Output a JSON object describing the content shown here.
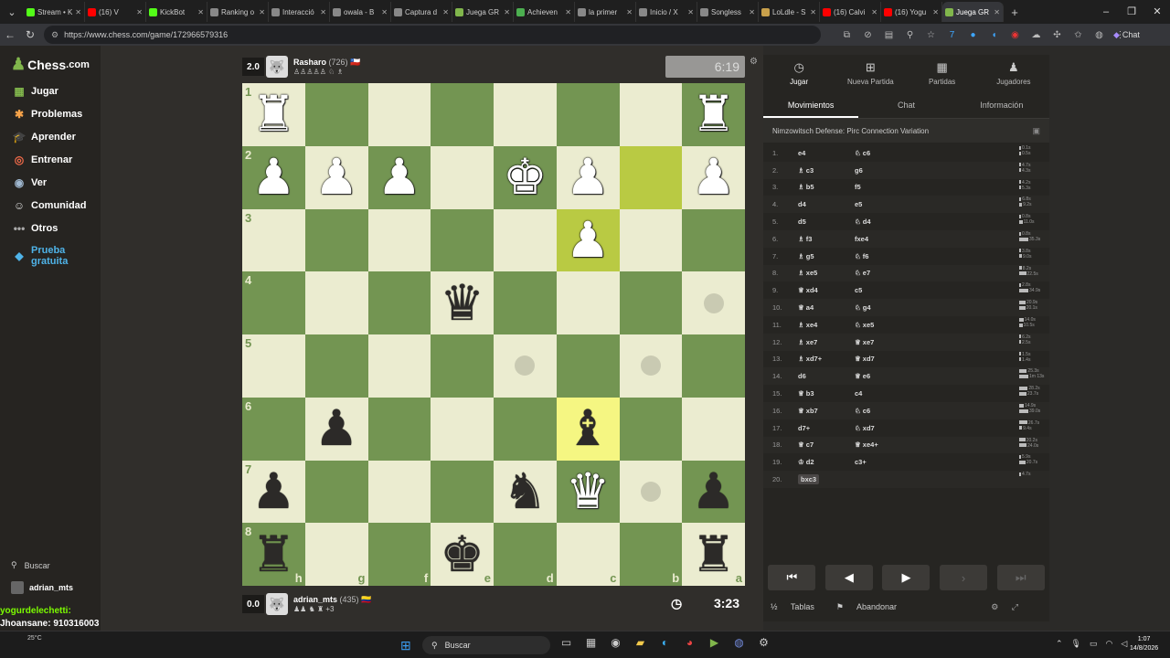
{
  "browser": {
    "tabs": [
      {
        "label": "Stream • K",
        "color": "#53fc18"
      },
      {
        "label": "(16) V",
        "color": "#ff0000"
      },
      {
        "label": "KickBot",
        "color": "#53fc18"
      },
      {
        "label": "Ranking o",
        "color": "#888888"
      },
      {
        "label": "Interacció",
        "color": "#888888"
      },
      {
        "label": "owala - B",
        "color": "#888888"
      },
      {
        "label": "Captura d",
        "color": "#888888"
      },
      {
        "label": "Juega GR",
        "color": "#81b64c"
      },
      {
        "label": "Achieven",
        "color": "#4caf50"
      },
      {
        "label": "la primer",
        "color": "#888888"
      },
      {
        "label": "Inicio / X",
        "color": "#888888"
      },
      {
        "label": "Songless",
        "color": "#888888"
      },
      {
        "label": "LoLdle - S",
        "color": "#c8a04b"
      },
      {
        "label": "(16) Calvi",
        "color": "#ff0000"
      },
      {
        "label": "(16) Yogu",
        "color": "#ff0000"
      },
      {
        "label": "Juega GR",
        "color": "#81b64c",
        "active": true
      }
    ],
    "url": "https://www.chess.com/game/172966579316",
    "chat_label": "Chat"
  },
  "sidebar": {
    "logo": "Chess",
    "logo_suffix": ".com",
    "items": [
      {
        "label": "Jugar",
        "icon": "play-board-icon",
        "color": "#81b64c"
      },
      {
        "label": "Problemas",
        "icon": "puzzle-icon",
        "color": "#f7a34a"
      },
      {
        "label": "Aprender",
        "icon": "learn-cap-icon",
        "color": "#4fb3e8"
      },
      {
        "label": "Entrenar",
        "icon": "train-icon",
        "color": "#f26b4a"
      },
      {
        "label": "Ver",
        "icon": "watch-icon",
        "color": "#a0b8d0"
      },
      {
        "label": "Comunidad",
        "icon": "community-icon",
        "color": "#dddddd"
      },
      {
        "label": "Otros",
        "icon": "more-icon",
        "color": "#aaaaaa"
      },
      {
        "label": "Prueba gratuita",
        "icon": "diamond-icon",
        "color": "#4fb3e8"
      }
    ],
    "search_label": "Buscar",
    "username": "adrian_mts"
  },
  "top_player": {
    "score": "2.0",
    "name": "Rasharo",
    "rating": "(726)",
    "captured": "♙♙♙♙♙ ♘ ♗",
    "clock": "6:19"
  },
  "bottom_player": {
    "score": "0.0",
    "name": "adrian_mts",
    "rating": "(435)",
    "captured": "♟♟ ♞ ♜ +3",
    "clock": "3:23"
  },
  "board": {
    "ranks": [
      "1",
      "2",
      "3",
      "4",
      "5",
      "6",
      "7",
      "8"
    ],
    "files": [
      "h",
      "g",
      "f",
      "e",
      "d",
      "c",
      "b",
      "a"
    ],
    "rows": [
      [
        "wR",
        "",
        "",
        "",
        "",
        "",
        "",
        "wR"
      ],
      [
        "wP",
        "wP",
        "wP",
        "",
        "wK",
        "wP",
        "",
        "wP"
      ],
      [
        "",
        "",
        "",
        "",
        "",
        "wP",
        "",
        ""
      ],
      [
        "",
        "",
        "",
        "bQ",
        "",
        "",
        "",
        "."
      ],
      [
        "",
        "",
        "",
        "",
        ".",
        "",
        ".",
        ""
      ],
      [
        "",
        "bP",
        "",
        "",
        "",
        "bB",
        "",
        ""
      ],
      [
        "bP",
        "",
        "",
        "",
        "bN",
        "wQ",
        ".",
        "bP"
      ],
      [
        "bR",
        "",
        "",
        "bK",
        "",
        "",
        "",
        "bR"
      ]
    ],
    "highlights": [
      [
        1,
        6
      ],
      [
        2,
        5
      ],
      [
        5,
        5
      ]
    ]
  },
  "panel": {
    "top_tabs": [
      {
        "label": "Jugar",
        "icon": "clock-icon",
        "active": true
      },
      {
        "label": "Nueva Partida",
        "icon": "plus-icon"
      },
      {
        "label": "Partidas",
        "icon": "grid-icon"
      },
      {
        "label": "Jugadores",
        "icon": "players-icon"
      }
    ],
    "sub_tabs": [
      {
        "label": "Movimientos",
        "active": true
      },
      {
        "label": "Chat"
      },
      {
        "label": "Información"
      }
    ],
    "opening": "Nimzowitsch Defense: Pirc Connection Variation",
    "moves": [
      {
        "n": "1.",
        "w": "e4",
        "b": "♘ c6",
        "t": [
          "0.1s",
          "0.5s"
        ]
      },
      {
        "n": "2.",
        "w": "♗ c3",
        "b": "g6",
        "t": [
          "4.7s",
          "4.3s"
        ]
      },
      {
        "n": "3.",
        "w": "♗ b5",
        "b": "f5",
        "t": [
          "4.2s",
          "5.3s"
        ]
      },
      {
        "n": "4.",
        "w": "d4",
        "b": "e5",
        "t": [
          "6.8s",
          "9.2s"
        ]
      },
      {
        "n": "5.",
        "w": "d5",
        "b": "♘ d4",
        "t": [
          "0.8s",
          "11.0s"
        ]
      },
      {
        "n": "6.",
        "w": "♗ f3",
        "b": "fxe4",
        "t": [
          "0.8s",
          "35.3s"
        ]
      },
      {
        "n": "7.",
        "w": "♗ g5",
        "b": "♘ f6",
        "t": [
          "3.8s",
          "9.0s"
        ]
      },
      {
        "n": "8.",
        "w": "♗ xe5",
        "b": "♘ e7",
        "t": [
          "8.2s",
          "22.5s"
        ]
      },
      {
        "n": "9.",
        "w": "♕ xd4",
        "b": "c5",
        "t": [
          "2.8s",
          "34.9s"
        ]
      },
      {
        "n": "10.",
        "w": "♕ a4",
        "b": "♘ g4",
        "t": [
          "20.9s",
          "20.1s"
        ]
      },
      {
        "n": "11.",
        "w": "♗ xe4",
        "b": "♘ xe5",
        "t": [
          "14.0s",
          "10.5s"
        ]
      },
      {
        "n": "12.",
        "w": "♗ xe7",
        "b": "♕ xe7",
        "t": [
          "6.2s",
          "2.5s"
        ]
      },
      {
        "n": "13.",
        "w": "♗ xd7+",
        "b": "♕ xd7",
        "t": [
          "1.5s",
          "1.4s"
        ]
      },
      {
        "n": "14.",
        "w": "d6",
        "b": "♕ e6",
        "t": [
          "25.3s",
          "1m 13s"
        ]
      },
      {
        "n": "15.",
        "w": "♕ b3",
        "b": "c4",
        "t": [
          "28.2s",
          "23.7s"
        ]
      },
      {
        "n": "16.",
        "w": "♕ xb7",
        "b": "♘ c6",
        "t": [
          "14.9s",
          "39.0s"
        ]
      },
      {
        "n": "17.",
        "w": "d7+",
        "b": "♘ xd7",
        "t": [
          "26.7s",
          "9.4s"
        ]
      },
      {
        "n": "18.",
        "w": "♕ c7",
        "b": "♕ xe4+",
        "t": [
          "20.2s",
          "24.0s"
        ]
      },
      {
        "n": "19.",
        "w": "♔ d2",
        "b": "c3+",
        "t": [
          "5.9s",
          "20.7s"
        ]
      },
      {
        "n": "20.",
        "w": "bxc3",
        "b": "",
        "t": [
          "4.7s"
        ],
        "current": true
      }
    ],
    "footer_tables": "Tablas",
    "footer_resign": "Abandonar"
  },
  "overlay": {
    "lines": [
      {
        "text": "yogurdelechetti:",
        "color": "#7cfc00"
      },
      {
        "text": "Jhoansane: 910316003",
        "color": "#ffffff"
      },
      {
        "text": "yogurdelechetti:",
        "color": "#7cfc00"
      }
    ]
  },
  "taskbar": {
    "temp": "25°C",
    "search": "Buscar",
    "time": "1:07",
    "date": "14/8/2026"
  }
}
